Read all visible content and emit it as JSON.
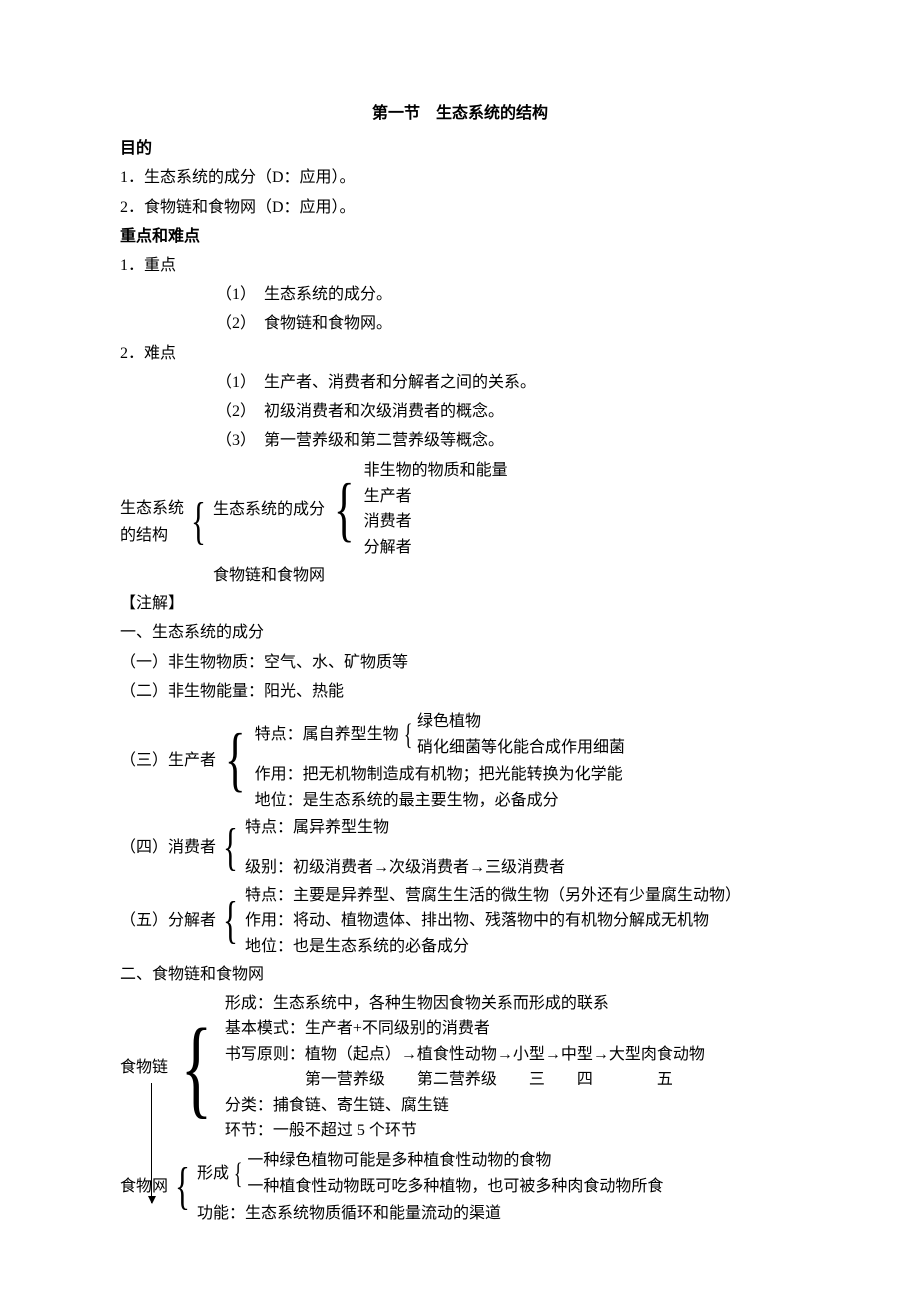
{
  "title": "第一节　生态系统的结构",
  "h_obj": "目的",
  "obj1": "1．生态系统的成分（D：应用）。",
  "obj2": "2．食物链和食物网（D：应用）。",
  "h_kd": "重点和难点",
  "kd1": "1．重点",
  "kd1_1": "（1）　生态系统的成分。",
  "kd1_2": "（2）　食物链和食物网。",
  "kd2": "2．难点",
  "kd2_1": "（1）　生产者、消费者和分解者之间的关系。",
  "kd2_2": "（2）　初级消费者和次级消费者的概念。",
  "kd2_3": "（3）　第一营养级和第二营养级等概念。",
  "s_root1": "生态系统",
  "s_root2": "的结构",
  "s_b1": "生态系统的成分",
  "s_b2": "食物链和食物网",
  "s_c1": "非生物的物质和能量",
  "s_c2": "生产者",
  "s_c3": "消费者",
  "s_c4": "分解者",
  "note_h": "【注解】",
  "n1": "一、生态系统的成分",
  "n1_1": "（一）非生物物质：空气、水、矿物质等",
  "n1_2": "（二）非生物能量：阳光、热能",
  "n1_3_label": "（三）生产者",
  "n1_3_a": "特点：属自养型生物",
  "n1_3_a1": "绿色植物",
  "n1_3_a2": "硝化细菌等化能合成作用细菌",
  "n1_3_b": "作用：把无机物制造成有机物；把光能转换为化学能",
  "n1_3_c": "地位：是生态系统的最主要生物，必备成分",
  "n1_4_label": "（四）消费者",
  "n1_4_a": "特点：属异养型生物",
  "n1_4_b": "级别：初级消费者→次级消费者→三级消费者",
  "n1_5_label": "（五）分解者",
  "n1_5_a": "特点：主要是异养型、营腐生生活的微生物（另外还有少量腐生动物）",
  "n1_5_b": "作用：将动、植物遗体、排出物、残落物中的有机物分解成无机物",
  "n1_5_c": "地位：也是生态系统的必备成分",
  "n2": "二、食物链和食物网",
  "fc_label": "食物链",
  "fc_1": "形成：生态系统中，各种生物因食物关系而形成的联系",
  "fc_2": "基本模式：生产者+不同级别的消费者",
  "fc_3a": "书写原则：植物（起点）→植食性动物→小型→中型→大型肉食动物",
  "fc_3b": "　　　　　第一营养级　　第二营养级　　三　　四　　　　五",
  "fc_4": "分类：捕食链、寄生链、腐生链",
  "fc_5": "环节：一般不超过 5 个环节",
  "fw_label": "食物网",
  "fw_f": "形成",
  "fw_f1": "一种绿色植物可能是多种植食性动物的食物",
  "fw_f2": "一种植食性动物既可吃多种植物，也可被多种肉食动物所食",
  "fw_g": "功能：生态系统物质循环和能量流动的渠道"
}
